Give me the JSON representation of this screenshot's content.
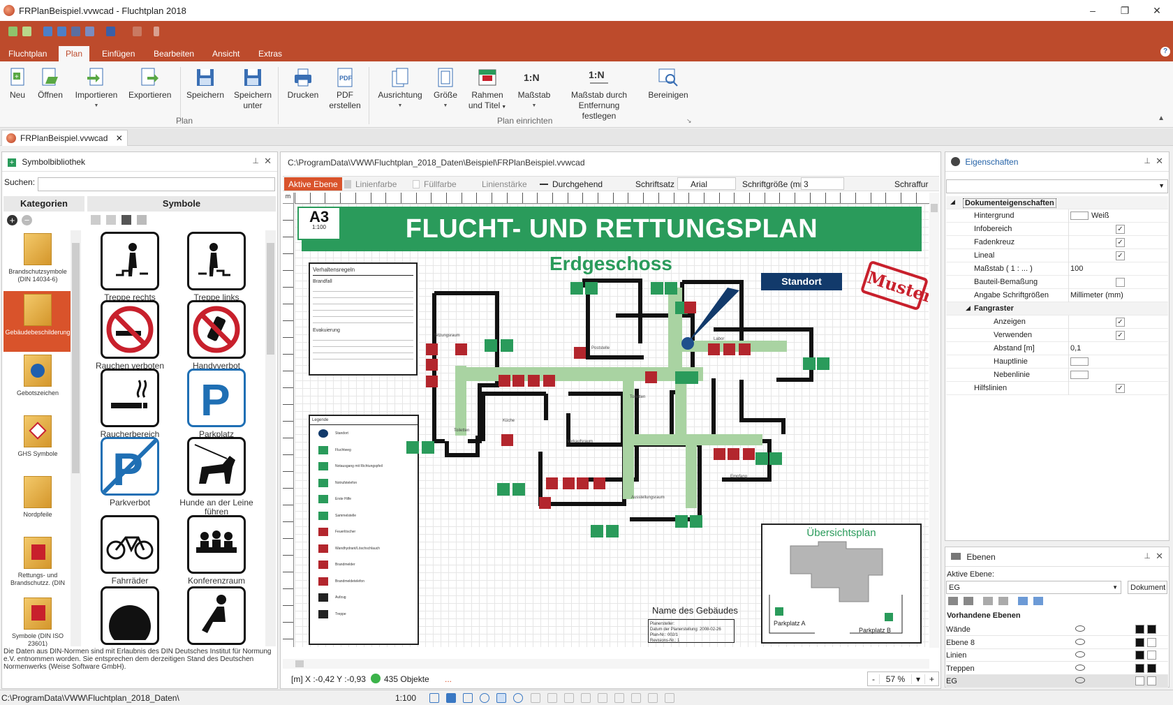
{
  "window": {
    "title": "FRPlanBeispiel.vvwcad - Fluchtplan 2018",
    "minimize": "–",
    "maximize": "❐",
    "close": "✕"
  },
  "ribbon": {
    "tabs": [
      "Fluchtplan",
      "Plan",
      "Einfügen",
      "Bearbeiten",
      "Ansicht",
      "Extras"
    ],
    "active_tab": "Plan",
    "buttons": {
      "neu": "Neu",
      "oeffnen": "Öffnen",
      "importieren": "Importieren",
      "exportieren": "Exportieren",
      "speichern": "Speichern",
      "speichern_unter_1": "Speichern",
      "speichern_unter_2": "unter",
      "drucken": "Drucken",
      "pdf_1": "PDF",
      "pdf_2": "erstellen",
      "ausrichtung": "Ausrichtung",
      "groesse": "Größe",
      "rahmen_1": "Rahmen",
      "rahmen_2": "und Titel",
      "massstab": "Maßstab",
      "massstab_entf_1": "Maßstab durch",
      "massstab_entf_2": "Entfernung festlegen",
      "bereinigen": "Bereinigen"
    },
    "groups": {
      "plan": "Plan",
      "plan_einrichten": "Plan einrichten"
    }
  },
  "doc_tab": {
    "label": "FRPlanBeispiel.vvwcad",
    "close": "✕"
  },
  "library": {
    "title": "Symbolbibliothek",
    "search_label": "Suchen:",
    "categories_header": "Kategorien",
    "symbols_header": "Symbole",
    "categories": [
      "Brandschutzsymbole (DIN 14034-6)",
      "Gebäudebeschilderung",
      "Gebotszeichen",
      "GHS Symbole",
      "Nordpfeile",
      "Rettungs- und Brandschutzz. (DIN",
      "Symbole (DIN ISO 23601)"
    ],
    "symbols": [
      "Treppe rechts",
      "Treppe links",
      "Rauchen verboten",
      "Handyverbot",
      "Raucherbereich",
      "Parkplatz",
      "Parkverbot",
      "Hunde an der Leine führen",
      "Fahrräder",
      "Konferenzraum"
    ],
    "footer": "Die Daten aus DIN-Normen sind mit Erlaubnis des DIN Deutsches Institut für Normung e.V. entnommen worden. Sie entsprechen dem derzeitigen Stand des Deutschen Normenwerks (Weise Software GmbH)."
  },
  "canvas": {
    "path": "C:\\ProgramData\\VWW\\Fluchtplan_2018_Daten\\Beispiel\\FRPlanBeispiel.vvwcad",
    "format_bar": {
      "aktive_ebene": "Aktive Ebene",
      "linienfarbe": "Linienfarbe",
      "fuellfarbe": "Füllfarbe",
      "linienstaerke": "Linienstärke",
      "durchgehend": "Durchgehend",
      "schriftsatz": "Schriftsatz",
      "font": "Arial",
      "schriftgroesse": "Schriftgröße (mm)",
      "size": "3",
      "schraffur": "Schraffur"
    },
    "ruler_unit": "m",
    "plan_title": "FLUCHT- UND RETTUNGSPLAN",
    "floor": "Erdgeschoss",
    "a3": "A3",
    "a3_scale": "1:100",
    "standort": "Standort",
    "muster": "Muster",
    "rules_title": "Verhaltensregeln",
    "rules_brandfall": "Brandfall",
    "rules_evakuierung": "Evakuierung",
    "legend_title": "Legende",
    "legend_items": [
      "Standort",
      "Fluchtweg",
      "Notausgang mit Richtungspfeil",
      "Notrufstelefon",
      "Erste Hilfe",
      "Sammelstelle",
      "Feuerlöscher",
      "Wandhydrant/Löschschlauch",
      "Brandmelder",
      "Brandmeldetelefon",
      "Aufzug",
      "Treppe"
    ],
    "rooms": [
      "Sitzungsraum",
      "Poststelle",
      "Labor",
      "Küche",
      "Toiletten",
      "Verkaufsraum",
      "Empfang",
      "Ausstellungsraum",
      "Toiletten"
    ],
    "overview_title": "Übersichtsplan",
    "parking_a": "Parkplatz A",
    "parking_b": "Parkplatz B",
    "building_name": "Name des Gebäudes",
    "stamp_lines": [
      "Planersteller:",
      "Datum der Planerstellung: 2008-02-26",
      "Plan-Nr.: 002/1",
      "Revisions-Nr.: 1"
    ],
    "status": {
      "coords": "[m] X :-0,42 Y :-0,93",
      "objects": "435 Objekte",
      "zoom": "57 %",
      "zoom_minus": "-",
      "zoom_plus": "+"
    }
  },
  "properties": {
    "title": "Eigenschaften",
    "section": "Dokumenteigenschaften",
    "rows": [
      {
        "k": "Hintergrund",
        "v": "Weiß",
        "type": "swatch"
      },
      {
        "k": "Infobereich",
        "type": "check",
        "checked": true
      },
      {
        "k": "Fadenkreuz",
        "type": "check",
        "checked": true
      },
      {
        "k": "Lineal",
        "type": "check",
        "checked": true
      },
      {
        "k": "Maßstab ( 1 : ... )",
        "v": "100",
        "type": "text"
      },
      {
        "k": "Bauteil-Bemaßung",
        "type": "check",
        "checked": false
      },
      {
        "k": "Angabe Schriftgrößen",
        "v": "Millimeter (mm)",
        "type": "text"
      }
    ],
    "fangraster": "Fangraster",
    "fang_rows": [
      {
        "k": "Anzeigen",
        "type": "check",
        "checked": true
      },
      {
        "k": "Verwenden",
        "type": "check",
        "checked": true
      },
      {
        "k": "Abstand [m]",
        "v": "0,1",
        "type": "text"
      },
      {
        "k": "Hauptlinie",
        "type": "swatch"
      },
      {
        "k": "Nebenlinie",
        "type": "swatch"
      }
    ],
    "hilfslinien": "Hilfslinien"
  },
  "layers": {
    "title": "Ebenen",
    "active_label": "Aktive Ebene:",
    "active_value": "EG",
    "dokument_btn": "Dokument",
    "existing_label": "Vorhandene Ebenen",
    "items": [
      "Wände",
      "Ebene 8",
      "Linien",
      "Treppen",
      "EG"
    ]
  },
  "statusbar": {
    "path": "C:\\ProgramData\\VWW\\Fluchtplan_2018_Daten\\",
    "scale": "1:100"
  },
  "colors": {
    "brand": "#bd4b2c",
    "plan_green": "#2a9b5b",
    "escape_path": "#a9d3a2",
    "accent_orange": "#d9532b"
  }
}
